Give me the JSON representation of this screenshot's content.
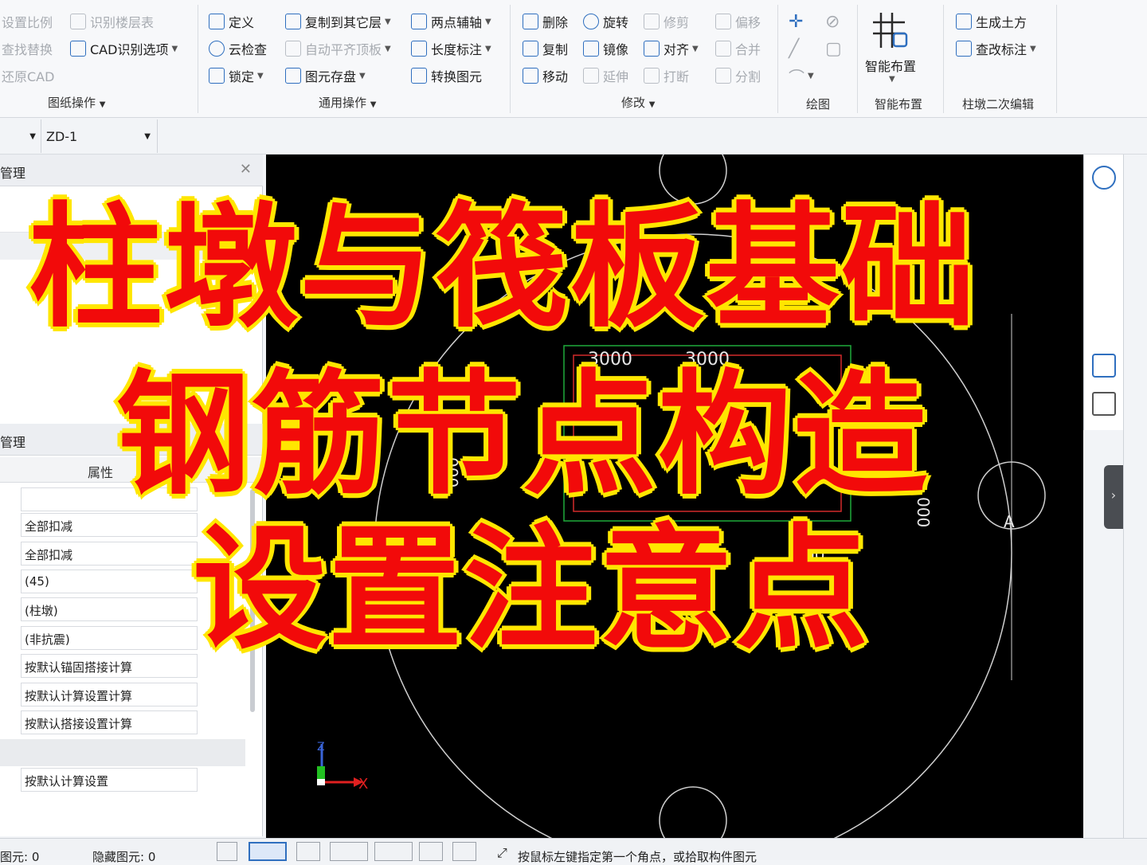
{
  "ribbon": {
    "col1": [
      "设置比例",
      "查找替换",
      "还原CAD"
    ],
    "col2": [
      "识别楼层表",
      "CAD识别选项"
    ],
    "group1_label": "图纸操作",
    "col3": [
      "定义",
      "云检查",
      "锁定"
    ],
    "col4": [
      "复制到其它层",
      "自动平齐顶板",
      "图元存盘"
    ],
    "col5": [
      "两点辅轴",
      "长度标注",
      "转换图元"
    ],
    "group2_label": "通用操作",
    "col6": [
      "删除",
      "复制",
      "移动"
    ],
    "col7": [
      "旋转",
      "镜像",
      "延伸"
    ],
    "col8": [
      "修剪",
      "对齐",
      "打断"
    ],
    "col9": [
      "偏移",
      "合并",
      "分割"
    ],
    "group3_label": "修改",
    "group4_label": "绘图",
    "smart_layout": "智能布置",
    "group5_label": "智能布置",
    "col10": [
      "生成土方",
      "查改标注"
    ],
    "group6_label": "柱墩二次编辑"
  },
  "toolbar2": {
    "combo_value": "ZD-1"
  },
  "left_panel": {
    "top_header": "管理",
    "prop_header": "管理",
    "prop_column": "属性",
    "prop_values": [
      "",
      "全部扣减",
      "全部扣减",
      "(45)",
      "(柱墩)",
      "(非抗震)",
      "按默认锚固搭接计算",
      "按默认计算设置计算",
      "按默认搭接设置计算",
      "",
      "按默认计算设置"
    ]
  },
  "canvas": {
    "dim_labels": [
      "3000",
      "3000",
      "000",
      "000",
      "00"
    ],
    "axis_label": "A",
    "axis_x": "X",
    "axis_z": "Z"
  },
  "status": {
    "selected": "图元: 0",
    "hidden": "隐藏图元: 0",
    "hint": "按鼠标左键指定第一个角点，或拾取构件图元"
  },
  "overlay": {
    "line1": "柱墩与筏板基础",
    "line2": "钢筋节点构造",
    "line3": "设置注意点",
    "text_color": "#f20a0a",
    "outline_color": "#ffe600"
  }
}
